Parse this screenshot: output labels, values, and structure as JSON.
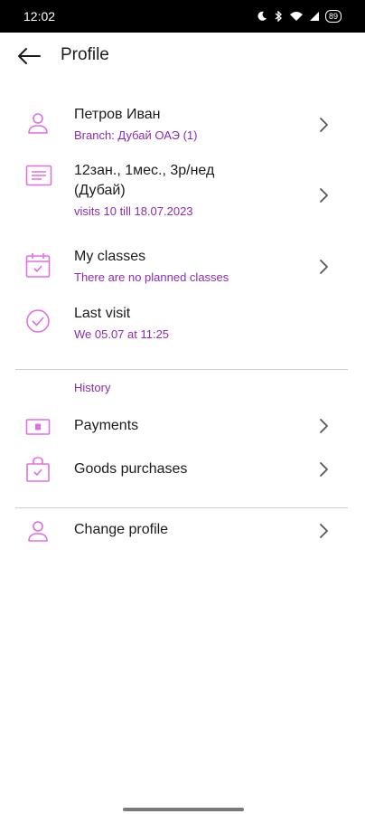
{
  "status_bar": {
    "time": "12:02",
    "battery": "89"
  },
  "app_bar": {
    "title": "Profile"
  },
  "profile": {
    "name": "Петров Иван",
    "branch": "Branch: Дубай ОАЭ (1)"
  },
  "subscription": {
    "line1": "12зан., 1мес., 3р/нед",
    "line2": "(Дубай)",
    "detail": "visits 10 till 18.07.2023"
  },
  "my_classes": {
    "label": "My classes",
    "detail": "There are no planned classes"
  },
  "last_visit": {
    "label": "Last visit",
    "detail": "We 05.07 at 11:25"
  },
  "history": {
    "section_label": "History",
    "payments_label": "Payments",
    "goods_label": "Goods purchases"
  },
  "change_profile": {
    "label": "Change profile"
  },
  "colors": {
    "accent": "#8b2bb0",
    "icon": "#e06fe0",
    "text": "#1b1b1b",
    "divider": "#cfcfcf"
  }
}
